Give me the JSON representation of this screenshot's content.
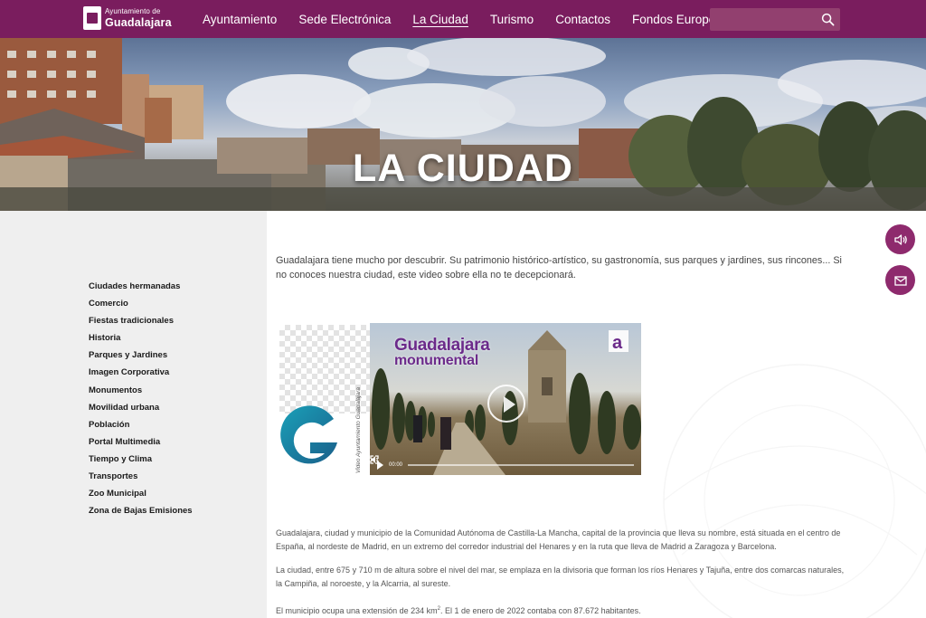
{
  "header": {
    "logo_small": "Ayuntamiento de",
    "logo_big": "Guadalajara",
    "nav": [
      "Ayuntamiento",
      "Sede Electrónica",
      "La Ciudad",
      "Turismo",
      "Contactos",
      "Fondos Europeos"
    ],
    "active_nav": "La Ciudad",
    "search_icon": "search-icon",
    "search_placeholder": ""
  },
  "hero": {
    "title": "LA CIUDAD"
  },
  "sidebar": {
    "items": [
      "Ciudades hermanadas",
      "Comercio",
      "Fiestas tradicionales",
      "Historia",
      "Parques y Jardines",
      "Imagen Corporativa",
      "Monumentos",
      "Movilidad urbana",
      "Población",
      "Portal Multimedia",
      "Tiempo y Clima",
      "Transportes",
      "Zoo Municipal",
      "Zona de Bajas Emisiones"
    ]
  },
  "main": {
    "intro": "Guadalajara tiene mucho por descubrir. Su patrimonio histórico-artístico, su gastronomía, sus parques y jardines, sus rincones... Si no conoces nuestra ciudad, este video sobre ella no te decepcionará.",
    "video": {
      "credit": "Video Ayuntamiento Guadalajara",
      "title_line1": "Guadalajara",
      "title_line2": "monumental",
      "time": "00:00"
    },
    "para1": "Guadalajara, ciudad y municipio de la Comunidad Autónoma de Castilla-La Mancha, capital de la provincia que lleva su nombre, está situada en el centro de España, al nordeste de Madrid, en un extremo del corredor industrial del Henares y en la ruta que lleva de Madrid a Zaragoza y Barcelona.",
    "para2": "La ciudad, entre 675 y 710 m de altura sobre el nivel del mar, se emplaza en la divisoria que forman los ríos Henares y Tajuña, entre dos comarcas naturales, la Campiña, al noroeste, y la Alcarria, al sureste.",
    "para3_before": "El municipio ocupa una extensión de 234 km",
    "para3_sup": "2",
    "para3_after": ". El 1 de enero de 2022 contaba con 87.672 habitantes."
  },
  "floating": {
    "audio_icon": "speaker-icon",
    "mail_icon": "mail-icon"
  },
  "colors": {
    "brand": "#7a1d5e",
    "float_button": "#8e2a6d"
  }
}
